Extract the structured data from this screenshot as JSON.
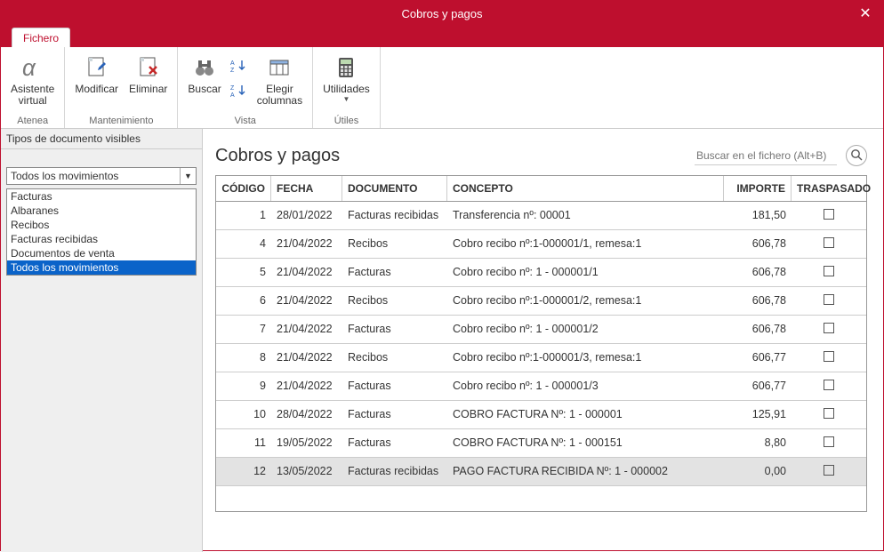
{
  "window": {
    "title": "Cobros y pagos"
  },
  "tabs": {
    "fichero": "Fichero"
  },
  "ribbon": {
    "groups": {
      "atenea": {
        "label": "Atenea",
        "asistente_l1": "Asistente",
        "asistente_l2": "virtual"
      },
      "mantenimiento": {
        "label": "Mantenimiento",
        "modificar": "Modificar",
        "eliminar": "Eliminar"
      },
      "vista": {
        "label": "Vista",
        "buscar": "Buscar",
        "elegir_l1": "Elegir",
        "elegir_l2": "columnas"
      },
      "utiles": {
        "label": "Útiles",
        "utilidades": "Utilidades"
      }
    }
  },
  "left": {
    "header": "Tipos de documento visibles",
    "combo_selected": "Todos los movimientos",
    "items": [
      "Facturas",
      "Albaranes",
      "Recibos",
      "Facturas recibidas",
      "Documentos de venta",
      "Todos los movimientos"
    ],
    "selected_index": 5
  },
  "main": {
    "title": "Cobros y pagos",
    "search_placeholder": "Buscar en el fichero (Alt+B)"
  },
  "table": {
    "columns": {
      "codigo": "CÓDIGO",
      "fecha": "FECHA",
      "documento": "DOCUMENTO",
      "concepto": "CONCEPTO",
      "importe": "IMPORTE",
      "traspasado": "TRASPASADO"
    },
    "rows": [
      {
        "codigo": "1",
        "fecha": "28/01/2022",
        "documento": "Facturas recibidas",
        "concepto": "Transferencia nº: 00001",
        "importe": "181,50",
        "traspasado": false
      },
      {
        "codigo": "4",
        "fecha": "21/04/2022",
        "documento": "Recibos",
        "concepto": "Cobro recibo nº:1-000001/1, remesa:1",
        "importe": "606,78",
        "traspasado": false
      },
      {
        "codigo": "5",
        "fecha": "21/04/2022",
        "documento": "Facturas",
        "concepto": "Cobro recibo nº: 1 - 000001/1",
        "importe": "606,78",
        "traspasado": false
      },
      {
        "codigo": "6",
        "fecha": "21/04/2022",
        "documento": "Recibos",
        "concepto": "Cobro recibo nº:1-000001/2, remesa:1",
        "importe": "606,78",
        "traspasado": false
      },
      {
        "codigo": "7",
        "fecha": "21/04/2022",
        "documento": "Facturas",
        "concepto": "Cobro recibo nº: 1 - 000001/2",
        "importe": "606,78",
        "traspasado": false
      },
      {
        "codigo": "8",
        "fecha": "21/04/2022",
        "documento": "Recibos",
        "concepto": "Cobro recibo nº:1-000001/3, remesa:1",
        "importe": "606,77",
        "traspasado": false
      },
      {
        "codigo": "9",
        "fecha": "21/04/2022",
        "documento": "Facturas",
        "concepto": "Cobro recibo nº: 1 - 000001/3",
        "importe": "606,77",
        "traspasado": false
      },
      {
        "codigo": "10",
        "fecha": "28/04/2022",
        "documento": "Facturas",
        "concepto": "COBRO FACTURA Nº: 1 - 000001",
        "importe": "125,91",
        "traspasado": false
      },
      {
        "codigo": "11",
        "fecha": "19/05/2022",
        "documento": "Facturas",
        "concepto": "COBRO FACTURA Nº: 1 - 000151",
        "importe": "8,80",
        "traspasado": false
      },
      {
        "codigo": "12",
        "fecha": "13/05/2022",
        "documento": "Facturas recibidas",
        "concepto": "PAGO FACTURA RECIBIDA Nº: 1 - 000002",
        "importe": "0,00",
        "traspasado": false,
        "selected": true
      }
    ]
  }
}
